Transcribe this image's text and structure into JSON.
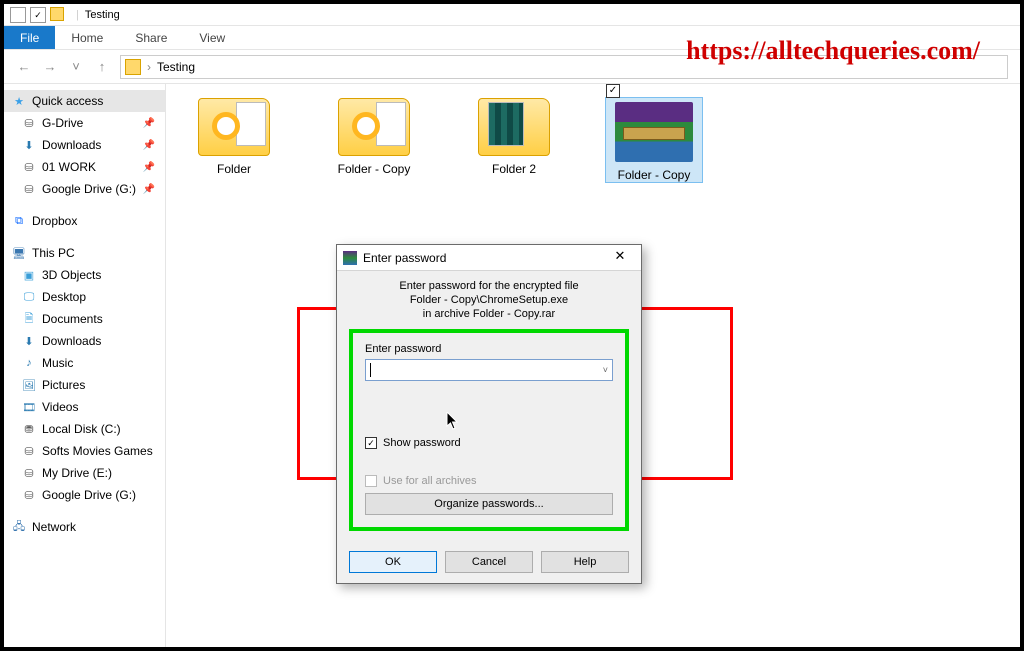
{
  "titlebar": {
    "location": "Testing"
  },
  "ribbon": {
    "file": "File",
    "home": "Home",
    "share": "Share",
    "view": "View"
  },
  "nav": {
    "back": "←",
    "fwd": "→",
    "up": "↑",
    "dd": "˅",
    "sep": "›",
    "path_item": "Testing"
  },
  "watermark": "https://alltechqueries.com/",
  "sidebar": {
    "quick_access": "Quick access",
    "items_qa": [
      "G-Drive",
      "Downloads",
      "01 WORK",
      "Google Drive (G:)"
    ],
    "dropbox": "Dropbox",
    "thispc": "This PC",
    "items_pc": [
      "3D Objects",
      "Desktop",
      "Documents",
      "Downloads",
      "Music",
      "Pictures",
      "Videos",
      "Local Disk (C:)",
      "Softs Movies Games",
      "My Drive (E:)",
      "Google Drive (G:)"
    ],
    "network": "Network"
  },
  "files": {
    "f1": "Folder",
    "f2": "Folder - Copy",
    "f3": "Folder 2",
    "f4": "Folder - Copy",
    "check": "✓"
  },
  "dialog": {
    "title": "Enter password",
    "msg1": "Enter password for the encrypted file",
    "msg2": "Folder - Copy\\ChromeSetup.exe",
    "msg3": "in archive Folder - Copy.rar",
    "label": "Enter password",
    "show_pw": "Show password",
    "use_all": "Use for all archives",
    "organize": "Organize passwords...",
    "ok": "OK",
    "cancel": "Cancel",
    "help": "Help",
    "close": "✕",
    "dd": "˅"
  }
}
